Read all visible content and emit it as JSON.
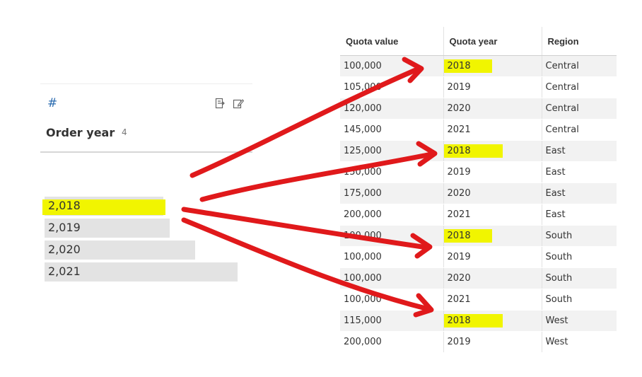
{
  "profile": {
    "type_icon": "#",
    "field_name": "Order year",
    "field_count": "4",
    "bars": [
      {
        "label": "2,018",
        "share": 0.56,
        "highlighted": true
      },
      {
        "label": "2,019",
        "share": 0.59,
        "highlighted": false
      },
      {
        "label": "2,020",
        "share": 0.71,
        "highlighted": false
      },
      {
        "label": "2,021",
        "share": 0.91,
        "highlighted": false
      }
    ]
  },
  "table": {
    "columns": [
      "Quota value",
      "Quota year",
      "Region"
    ],
    "rows": [
      {
        "quota_value": "100,000",
        "quota_year": "2018",
        "region": "Central",
        "highlight": true
      },
      {
        "quota_value": "105,000",
        "quota_year": "2019",
        "region": "Central",
        "highlight": false
      },
      {
        "quota_value": "120,000",
        "quota_year": "2020",
        "region": "Central",
        "highlight": false
      },
      {
        "quota_value": "145,000",
        "quota_year": "2021",
        "region": "Central",
        "highlight": false
      },
      {
        "quota_value": "125,000",
        "quota_year": "2018",
        "region": "East",
        "highlight": true
      },
      {
        "quota_value": "150,000",
        "quota_year": "2019",
        "region": "East",
        "highlight": false
      },
      {
        "quota_value": "175,000",
        "quota_year": "2020",
        "region": "East",
        "highlight": false
      },
      {
        "quota_value": "200,000",
        "quota_year": "2021",
        "region": "East",
        "highlight": false
      },
      {
        "quota_value": "100,000",
        "quota_year": "2018",
        "region": "South",
        "highlight": true
      },
      {
        "quota_value": "100,000",
        "quota_year": "2019",
        "region": "South",
        "highlight": false
      },
      {
        "quota_value": "100,000",
        "quota_year": "2020",
        "region": "South",
        "highlight": false
      },
      {
        "quota_value": "100,000",
        "quota_year": "2021",
        "region": "South",
        "highlight": false
      },
      {
        "quota_value": "115,000",
        "quota_year": "2018",
        "region": "West",
        "highlight": true
      },
      {
        "quota_value": "200,000",
        "quota_year": "2019",
        "region": "West",
        "highlight": false
      }
    ]
  },
  "colors": {
    "highlight": "#f1f500",
    "arrow": "#e0191b",
    "bar": "#e3e3e3",
    "type_icon": "#2b6cb0"
  }
}
